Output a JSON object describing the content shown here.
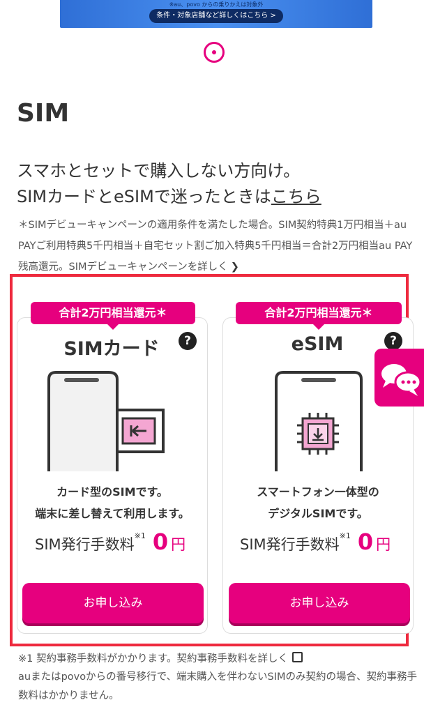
{
  "banner": {
    "note": "※au、povo からの乗りかえは対象外",
    "button_label": "条件・対象店舗など詳しくはこちら >"
  },
  "section": {
    "title": "SIM",
    "lead_line1": "スマホとセットで購入しない方向け。",
    "lead_line2_prefix": "SIMカードとeSIMで迷ったときは",
    "lead_line2_link": "こちら",
    "campaign_note": "＊SIMデビューキャンペーンの適用条件を満たした場合。SIM契約特典1万円相当＋au PAYご利用特典5千円相当＋自宅セット割ご加入特典5千円相当＝合計2万円相当au PAY残高還元。SIMデビューキャンペーンを詳しく",
    "campaign_arrow": "❯"
  },
  "cards": [
    {
      "badge": "合計2万円相当還元＊",
      "title": "SIMカード",
      "help": "?",
      "desc_line1": "カード型のSIMです。",
      "desc_line2": "端末に差し替えて利用します。",
      "fee_label": "SIM発行手数料",
      "fee_sup": "※1",
      "fee_value": "0",
      "fee_unit": "円",
      "button": "お申し込み"
    },
    {
      "badge": "合計2万円相当還元＊",
      "title": "eSIM",
      "help": "?",
      "desc_line1": "スマートフォン一体型の",
      "desc_line2": "デジタルSIMです。",
      "fee_label": "SIM発行手数料",
      "fee_sup": "※1",
      "fee_value": "0",
      "fee_unit": "円",
      "button": "お申し込み"
    }
  ],
  "footnotes": {
    "line1": "※1 契約事務手数料がかかります。契約事務手数料を詳しく",
    "line2": "auまたはpovoからの番号移行で、端末購入を伴わないSIMのみ契約の場合、契約事務手数料はかかりません。"
  },
  "colors": {
    "accent": "#e6007e",
    "highlight": "#ee2a3e"
  }
}
